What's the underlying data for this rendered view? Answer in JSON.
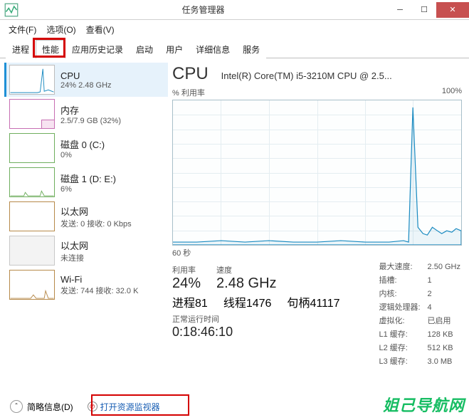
{
  "window": {
    "title": "任务管理器"
  },
  "menu": {
    "file": "文件(F)",
    "options": "选项(O)",
    "view": "查看(V)"
  },
  "tabs": {
    "process": "进程",
    "performance": "性能",
    "history": "应用历史记录",
    "startup": "启动",
    "users": "用户",
    "details": "详细信息",
    "services": "服务"
  },
  "sidebar": {
    "items": [
      {
        "name": "CPU",
        "sub": "24% 2.48 GHz",
        "thumb": "cpu"
      },
      {
        "name": "内存",
        "sub": "2.5/7.9 GB (32%)",
        "thumb": "mem"
      },
      {
        "name": "磁盘 0 (C:)",
        "sub": "0%",
        "thumb": "disk"
      },
      {
        "name": "磁盘 1 (D: E:)",
        "sub": "6%",
        "thumb": "disk"
      },
      {
        "name": "以太网",
        "sub": "发送: 0 接收: 0 Kbps",
        "thumb": "net"
      },
      {
        "name": "以太网",
        "sub": "未连接",
        "thumb": "net2"
      },
      {
        "name": "Wi-Fi",
        "sub": "发送: 744 接收: 32.0 K",
        "thumb": "net"
      }
    ]
  },
  "main": {
    "title": "CPU",
    "desc": "Intel(R) Core(TM) i5-3210M CPU @ 2.5...",
    "ylabel": "% 利用率",
    "ymax": "100%",
    "xlabel": "60 秒",
    "stats": {
      "util_label": "利用率",
      "util": "24%",
      "speed_label": "速度",
      "speed": "2.48 GHz",
      "proc_label": "进程",
      "proc": "81",
      "thr_label": "线程",
      "thr": "1476",
      "hnd_label": "句柄",
      "hnd": "41117"
    },
    "right": {
      "maxspeed_l": "最大速度:",
      "maxspeed": "2.50 GHz",
      "sockets_l": "插槽:",
      "sockets": "1",
      "cores_l": "内核:",
      "cores": "2",
      "logi_l": "逻辑处理器:",
      "logi": "4",
      "virt_l": "虚拟化:",
      "virt": "已启用",
      "l1_l": "L1 缓存:",
      "l1": "128 KB",
      "l2_l": "L2 缓存:",
      "l2": "512 KB",
      "l3_l": "L3 缓存:",
      "l3": "3.0 MB"
    },
    "uptime_l": "正常运行时间",
    "uptime": "0:18:46:10"
  },
  "footer": {
    "brief": "简略信息(D)",
    "resmon": "打开资源监视器"
  },
  "watermark": "姐己导航网",
  "chart_data": {
    "type": "line",
    "title": "% 利用率",
    "xlabel": "60 秒",
    "ylabel": "% 利用率",
    "ylim": [
      0,
      100
    ],
    "x": [
      0,
      5,
      10,
      15,
      20,
      25,
      30,
      35,
      40,
      45,
      48,
      49,
      50,
      51,
      52,
      53,
      54,
      55,
      56,
      57,
      58,
      59,
      60
    ],
    "values": [
      2,
      2,
      3,
      2,
      3,
      2,
      2,
      3,
      2,
      2,
      3,
      2,
      95,
      12,
      8,
      7,
      12,
      10,
      8,
      10,
      9,
      11,
      10
    ]
  }
}
